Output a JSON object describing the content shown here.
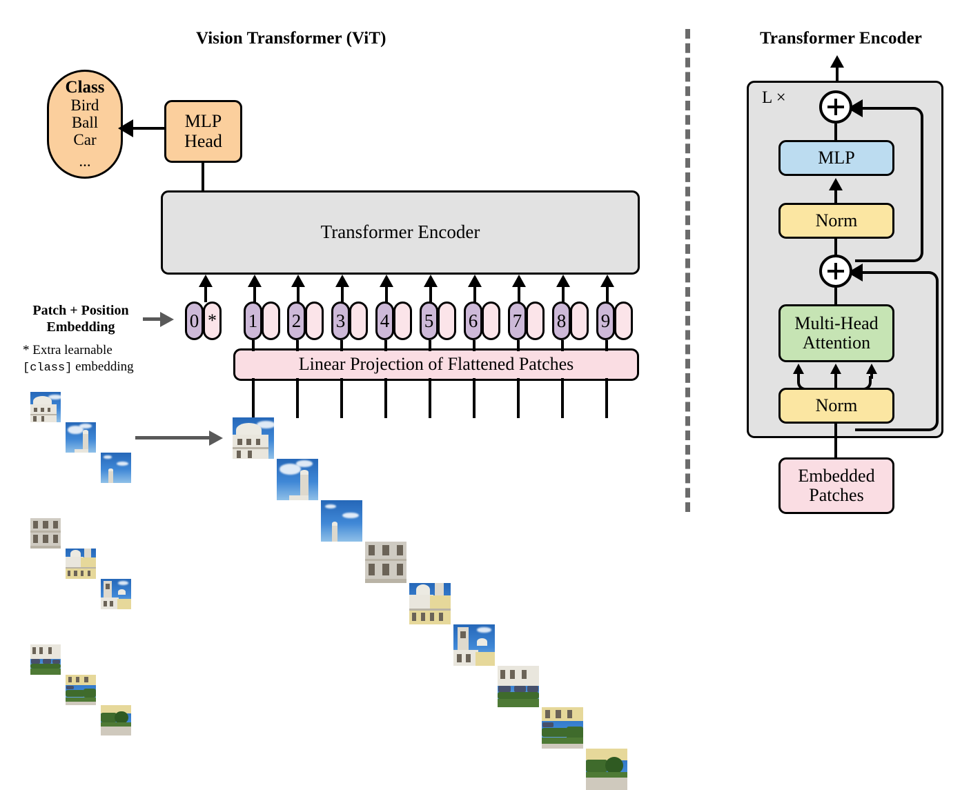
{
  "left_panel": {
    "title": "Vision Transformer (ViT)",
    "class_box": {
      "heading": "Class",
      "items": [
        "Bird",
        "Ball",
        "Car",
        "..."
      ],
      "color": "#fbcf9d"
    },
    "mlp_head": {
      "line1": "MLP",
      "line2": "Head",
      "color": "#fbcf9d"
    },
    "encoder_box": {
      "label": "Transformer Encoder",
      "color": "#e2e2e2"
    },
    "linear_projection": {
      "label": "Linear Projection of Flattened Patches",
      "color": "#fadde3"
    },
    "patch_position_label": {
      "line1": "Patch + Position",
      "line2": "Embedding"
    },
    "footnote": {
      "line1": "* Extra learnable",
      "code": "[class]",
      "line2_rest": " embedding"
    },
    "tokens": [
      {
        "index": "0",
        "extra": "*",
        "has_extra": true
      },
      {
        "index": "1",
        "extra": "",
        "has_extra": false
      },
      {
        "index": "2",
        "extra": "",
        "has_extra": false
      },
      {
        "index": "3",
        "extra": "",
        "has_extra": false
      },
      {
        "index": "4",
        "extra": "",
        "has_extra": false
      },
      {
        "index": "5",
        "extra": "",
        "has_extra": false
      },
      {
        "index": "6",
        "extra": "",
        "has_extra": false
      },
      {
        "index": "7",
        "extra": "",
        "has_extra": false
      },
      {
        "index": "8",
        "extra": "",
        "has_extra": false
      },
      {
        "index": "9",
        "extra": "",
        "has_extra": false
      }
    ],
    "token_colors": {
      "index_chip": "#cdb9d8",
      "embedding_chip": "#fbe4e9"
    },
    "source_image": {
      "description": "palace-photo-3x3-grid",
      "rows": 3,
      "cols": 3
    },
    "patch_strip": {
      "description": "palace-photo-patch-sequence",
      "count": 9
    }
  },
  "right_panel": {
    "title": "Transformer Encoder",
    "repeat_label": "L ×",
    "outer_box_color": "#e2e2e2",
    "blocks": [
      {
        "name": "mlp",
        "label": "MLP",
        "color": "#bcdcf0"
      },
      {
        "name": "norm-top",
        "label": "Norm",
        "color": "#fbe6a2"
      },
      {
        "name": "multi-head-attention",
        "line1": "Multi-Head",
        "line2": "Attention",
        "color": "#c6e4b4"
      },
      {
        "name": "norm-bottom",
        "label": "Norm",
        "color": "#fbe6a2"
      },
      {
        "name": "embedded-patches",
        "line1": "Embedded",
        "line2": "Patches",
        "color": "#fadde3"
      }
    ],
    "add_nodes": [
      {
        "symbol": "+"
      },
      {
        "symbol": "+"
      }
    ]
  },
  "divider": {
    "style": "dashed",
    "color": "#6b6b6b"
  }
}
